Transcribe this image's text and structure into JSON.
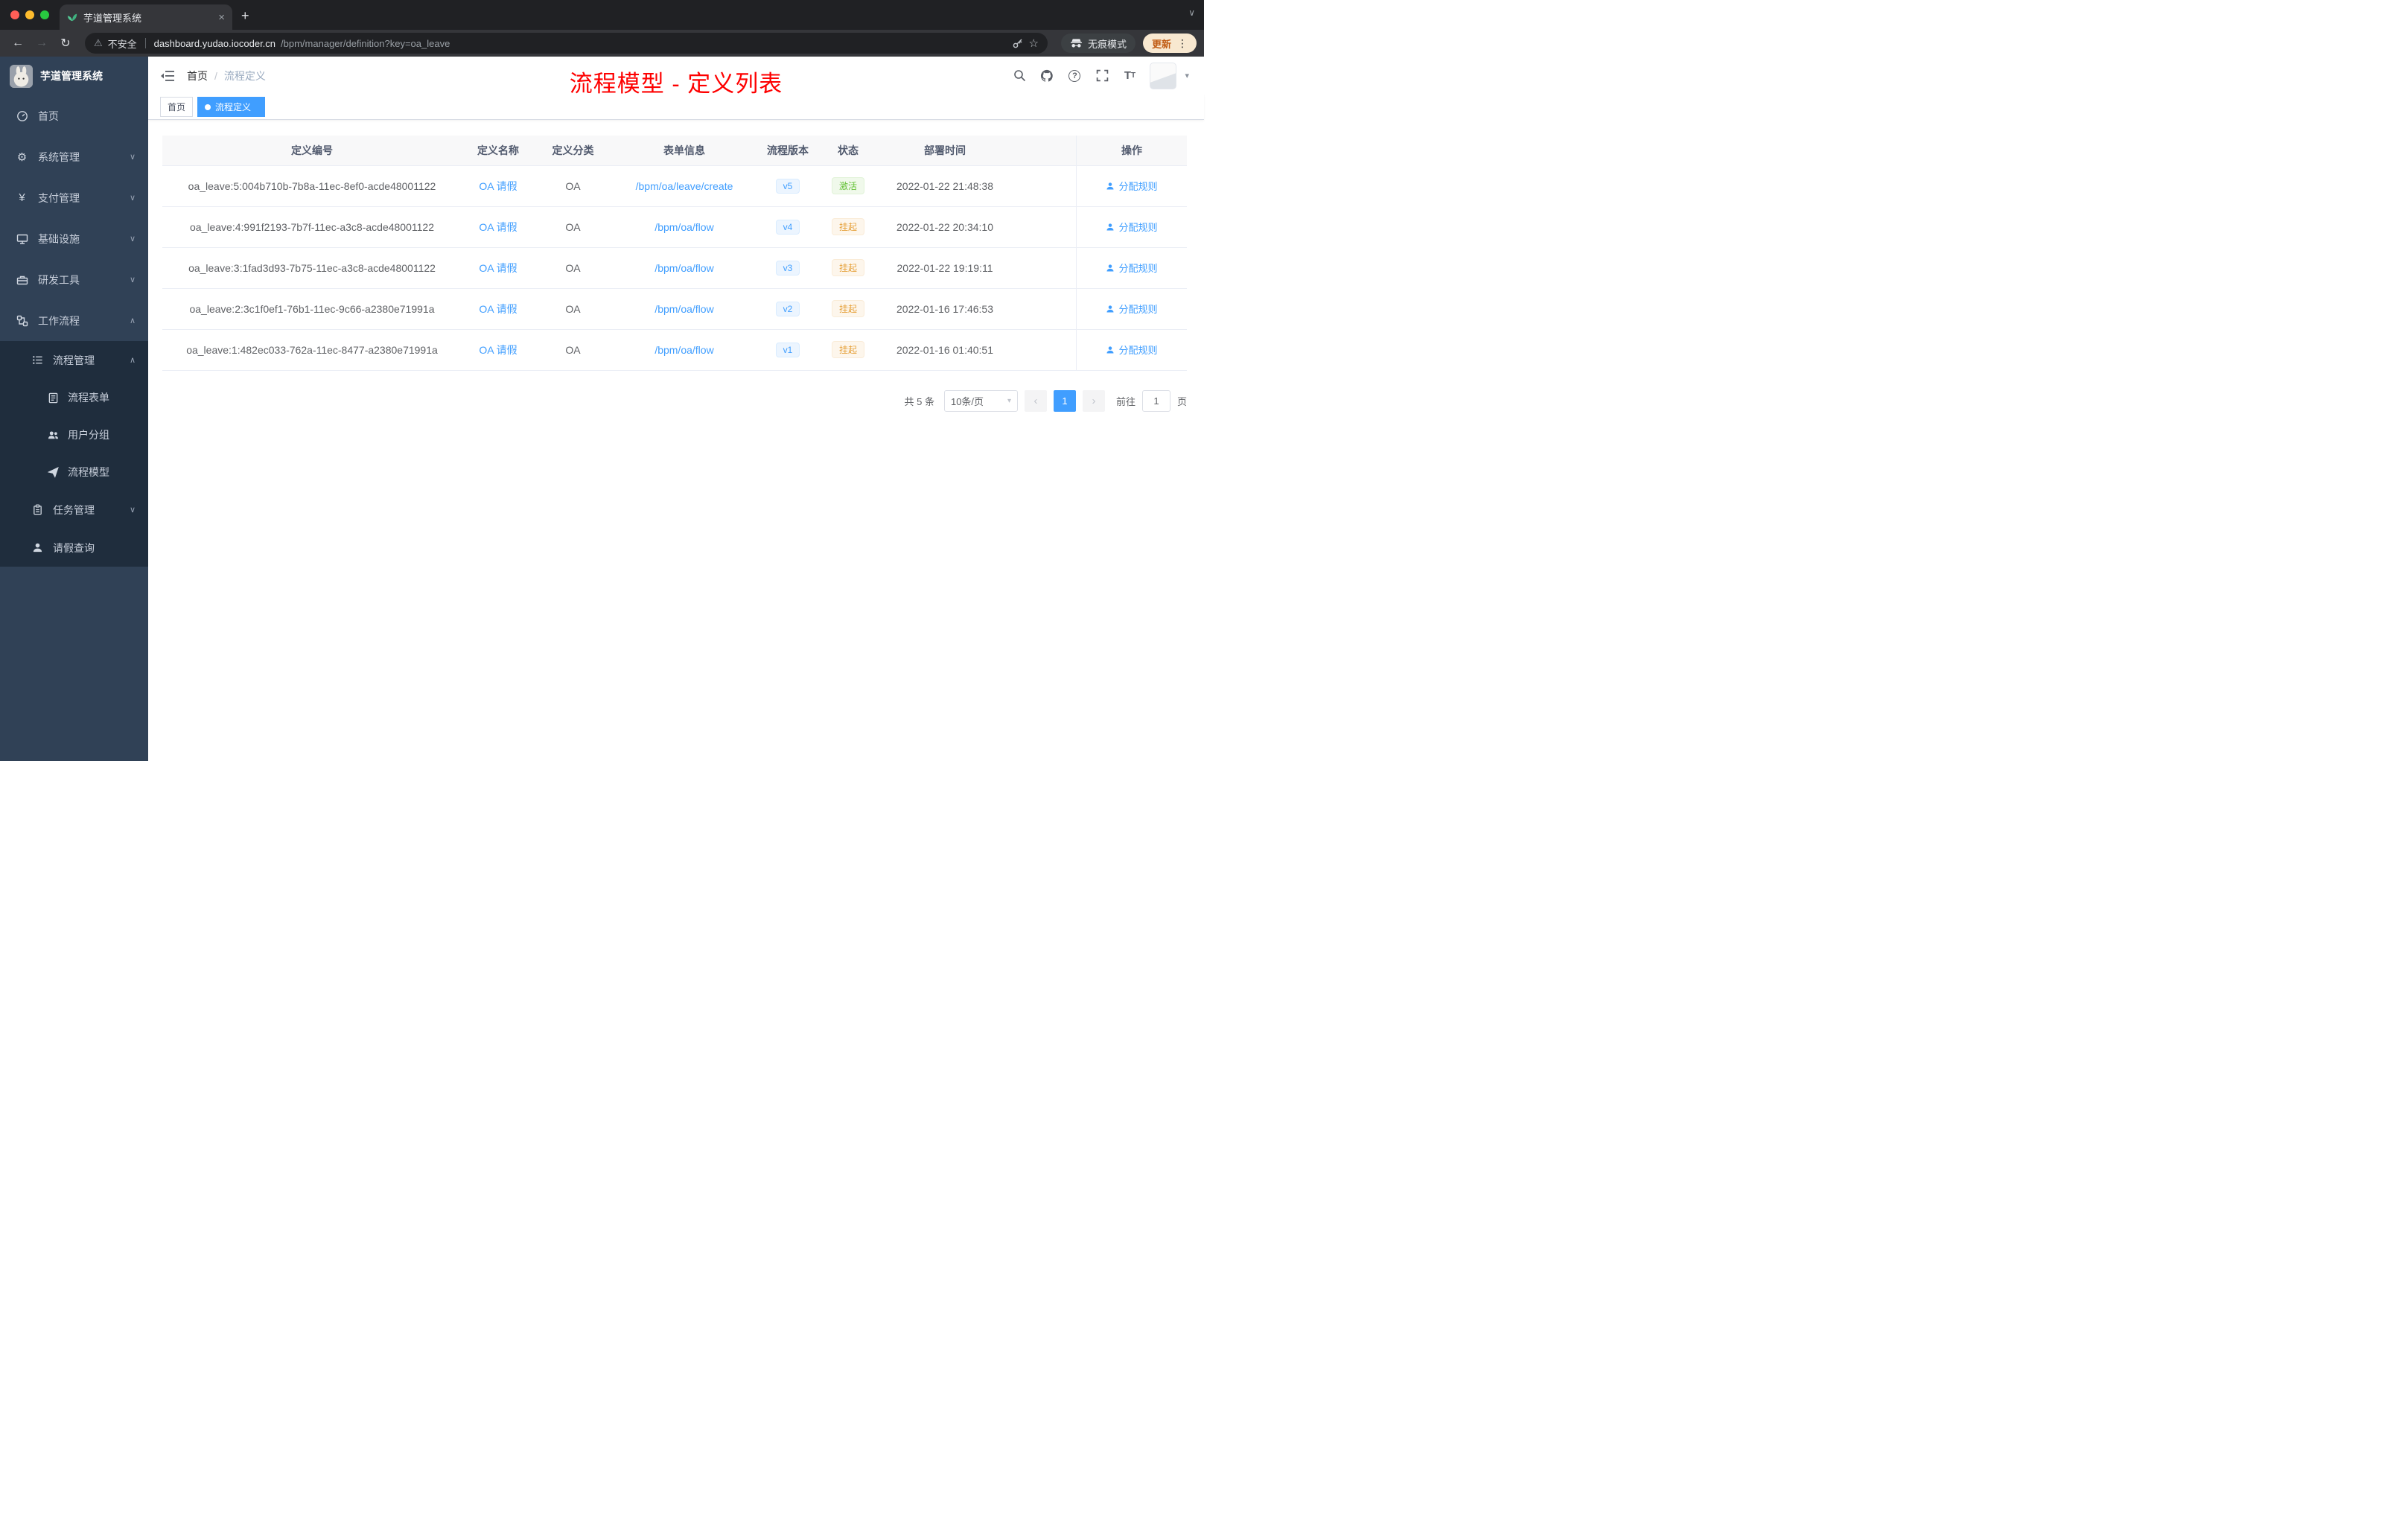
{
  "browser": {
    "tab_title": "芋道管理系统",
    "security_label": "不安全",
    "url_host": "dashboard.yudao.iocoder.cn",
    "url_path": "/bpm/manager/definition?key=oa_leave",
    "incognito_label": "无痕模式",
    "update_label": "更新"
  },
  "icons": {
    "close": "×",
    "plus": "+",
    "chevron_down": "∨",
    "chevron_up": "∧",
    "back": "←",
    "forward": "→",
    "refresh": "↻",
    "warning": "⚠",
    "star": "☆",
    "dots": "⋮",
    "gear": "⚙",
    "yen": "¥",
    "help": "?",
    "font_letter": "T",
    "breadcrumb_sep": "/",
    "select_caret": "▾",
    "prev": "‹",
    "next": "›"
  },
  "sidebar": {
    "logo_title": "芋道管理系统",
    "menu": [
      {
        "label": "首页"
      },
      {
        "label": "系统管理"
      },
      {
        "label": "支付管理"
      },
      {
        "label": "基础设施"
      },
      {
        "label": "研发工具"
      },
      {
        "label": "工作流程"
      }
    ],
    "submenu": {
      "manage_label": "流程管理",
      "children": [
        {
          "label": "流程表单"
        },
        {
          "label": "用户分组"
        },
        {
          "label": "流程模型"
        }
      ],
      "tasks_label": "任务管理",
      "leave_label": "请假查询"
    }
  },
  "header": {
    "breadcrumb_home": "首页",
    "breadcrumb_current": "流程定义",
    "annotation": "流程模型 - 定义列表"
  },
  "tags": {
    "home_label": "首页",
    "active_label": "流程定义"
  },
  "table": {
    "columns": [
      "定义编号",
      "定义名称",
      "定义分类",
      "表单信息",
      "流程版本",
      "状态",
      "部署时间",
      "操作"
    ],
    "rows": [
      {
        "id": "oa_leave:5:004b710b-7b8a-11ec-8ef0-acde48001122",
        "name": "OA 请假",
        "category": "OA",
        "form": "/bpm/oa/leave/create",
        "version": "v5",
        "status": "激活",
        "deploy_time": "2022-01-22 21:48:38",
        "action": "分配规则"
      },
      {
        "id": "oa_leave:4:991f2193-7b7f-11ec-a3c8-acde48001122",
        "name": "OA 请假",
        "category": "OA",
        "form": "/bpm/oa/flow",
        "version": "v4",
        "status": "挂起",
        "deploy_time": "2022-01-22 20:34:10",
        "action": "分配规则"
      },
      {
        "id": "oa_leave:3:1fad3d93-7b75-11ec-a3c8-acde48001122",
        "name": "OA 请假",
        "category": "OA",
        "form": "/bpm/oa/flow",
        "version": "v3",
        "status": "挂起",
        "deploy_time": "2022-01-22 19:19:11",
        "action": "分配规则"
      },
      {
        "id": "oa_leave:2:3c1f0ef1-76b1-11ec-9c66-a2380e71991a",
        "name": "OA 请假",
        "category": "OA",
        "form": "/bpm/oa/flow",
        "version": "v2",
        "status": "挂起",
        "deploy_time": "2022-01-16 17:46:53",
        "action": "分配规则"
      },
      {
        "id": "oa_leave:1:482ec033-762a-11ec-8477-a2380e71991a",
        "name": "OA 请假",
        "category": "OA",
        "form": "/bpm/oa/flow",
        "version": "v1",
        "status": "挂起",
        "deploy_time": "2022-01-16 01:40:51",
        "action": "分配规则"
      }
    ]
  },
  "pagination": {
    "total": "共 5 条",
    "page_size": "10条/页",
    "current_page": "1",
    "goto_label": "前往",
    "goto_value": "1",
    "unit_label": "页"
  }
}
